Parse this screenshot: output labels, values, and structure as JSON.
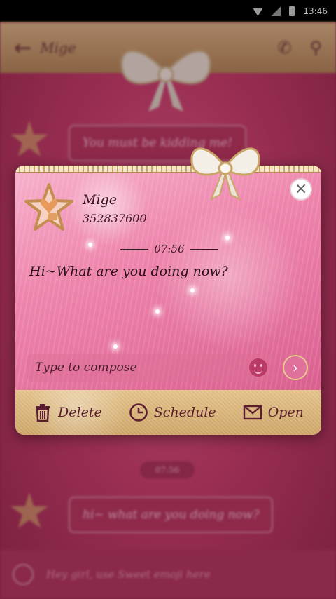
{
  "status_bar": {
    "time": "13:46"
  },
  "background_chat": {
    "contact_name": "Mige",
    "bubble_1": "You must be kidding me!",
    "time_chip": "07:56",
    "bubble_2": "hi~ what are you doing now?",
    "compose_placeholder": "Hey girl, use Sweet emoji here"
  },
  "dialog": {
    "sender_name": "Mige",
    "sender_number": "352837600",
    "time": "07:56",
    "message": "Hi~What are you doing now?",
    "compose_placeholder": "Type to compose",
    "close_icon": "close-icon",
    "send_icon": "chevron-right-icon",
    "actions": [
      {
        "label": "Delete",
        "icon": "trash-icon"
      },
      {
        "label": "Schedule",
        "icon": "clock-icon"
      },
      {
        "label": "Open",
        "icon": "envelope-icon"
      }
    ]
  },
  "colors": {
    "accent_pink": "#e5739f",
    "gold": "#d9b070",
    "text_dark": "#3a1420"
  }
}
